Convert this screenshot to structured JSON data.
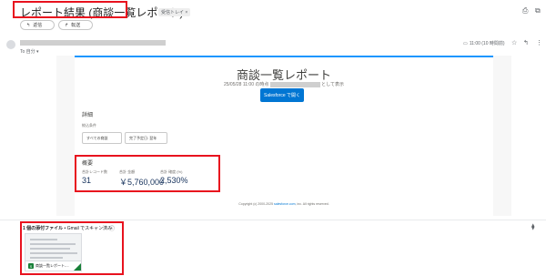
{
  "header": {
    "subject": "レポート結果 (商談一覧レポート)",
    "label_chip": "受信トレイ ×",
    "print_icon": "print-icon",
    "open_new_icon": "open-in-new-icon",
    "reply_label": "返信",
    "forward_label": "転送"
  },
  "message": {
    "to_line": "To 自分 ▾",
    "timestamp": "11:00 (10 時間前)",
    "icons": [
      "label-icon",
      "star-icon",
      "reply-icon",
      "more-icon"
    ]
  },
  "report": {
    "title": "商談一覧レポート",
    "line_prefix": "25/05/28 11:00 の時点",
    "line_suffix": "として表示",
    "open_button": "Salesforce で開く",
    "details_heading": "詳細",
    "criteria_label": "絞込条件",
    "criteria": [
      "すべての商談",
      "完了予定日: 翌年"
    ],
    "summary_heading": "概要",
    "metrics": [
      {
        "label": "合計レコード数",
        "value": "31"
      },
      {
        "label": "合計 金額",
        "value": "￥5,760,000"
      },
      {
        "label": "合計 確度 (%)",
        "value": "2,530%"
      }
    ],
    "copyright_prefix": "Copyright (c) 2000-2025 ",
    "copyright_link": "salesforce.com",
    "copyright_suffix": ", inc. All rights reserved."
  },
  "attachments": {
    "title_bold": "1 個の添付ファイル",
    "title_rest": " • Gmail でスキャン済み",
    "file_name": "商談一覧レポート-...",
    "file_icon_letter": "S"
  },
  "colors": {
    "annotation": "#e8121e",
    "salesforce_blue": "#0176d3",
    "sheets_green": "#188038"
  }
}
